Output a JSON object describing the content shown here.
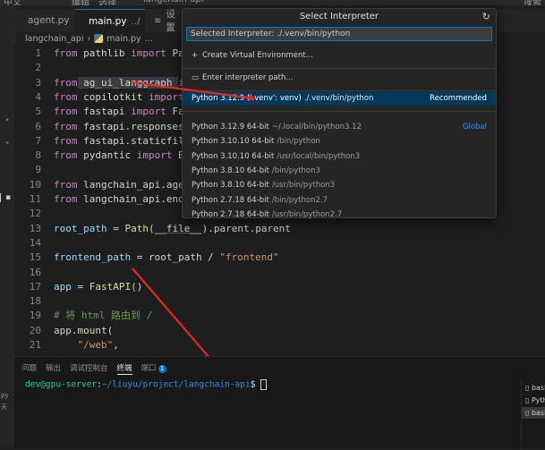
{
  "top_fragments": [
    "中文",
    "编辑",
    "选择",
    "langchain-api",
    "搜索"
  ],
  "tabs": [
    {
      "label": "agent.py"
    },
    {
      "label": "main.py",
      "suffix": "../"
    },
    {
      "label": "设置"
    }
  ],
  "breadcrumb": {
    "folder": "langchain_api",
    "sep": "›",
    "file": "main.py",
    "extra": "..."
  },
  "editor": {
    "lines": [
      {
        "n": "1",
        "parts": [
          [
            "kw",
            "from"
          ],
          [
            "plain",
            " pathlib "
          ],
          [
            "kw",
            "import"
          ],
          [
            "plain",
            " Path"
          ]
        ]
      },
      {
        "n": "2",
        "parts": []
      },
      {
        "n": "3",
        "parts": [
          [
            "kw",
            "from"
          ],
          [
            "plain",
            " ag_ui_langgraph "
          ],
          [
            "kw",
            "import"
          ]
        ]
      },
      {
        "n": "4",
        "parts": [
          [
            "kw",
            "from"
          ],
          [
            "plain",
            " copilotkit "
          ],
          [
            "kw",
            "import"
          ],
          [
            "plain",
            " La"
          ]
        ]
      },
      {
        "n": "5",
        "parts": [
          [
            "kw",
            "from"
          ],
          [
            "plain",
            " fastapi "
          ],
          [
            "kw",
            "import"
          ],
          [
            "plain",
            " FastAP"
          ]
        ]
      },
      {
        "n": "6",
        "parts": [
          [
            "kw",
            "from"
          ],
          [
            "plain",
            " fastapi.responses "
          ],
          [
            "kw",
            "imp"
          ]
        ]
      },
      {
        "n": "7",
        "parts": [
          [
            "kw",
            "from"
          ],
          [
            "plain",
            " fastapi.staticfiles "
          ],
          [
            "kw",
            "i"
          ]
        ]
      },
      {
        "n": "8",
        "parts": [
          [
            "kw",
            "from"
          ],
          [
            "plain",
            " pydantic "
          ],
          [
            "kw",
            "import"
          ],
          [
            "plain",
            " BaseM"
          ]
        ]
      },
      {
        "n": "9",
        "parts": []
      },
      {
        "n": "10",
        "parts": [
          [
            "kw",
            "from"
          ],
          [
            "plain",
            " langchain_api.agent.a"
          ]
        ]
      },
      {
        "n": "11",
        "parts": [
          [
            "kw",
            "from"
          ],
          [
            "plain",
            " langchain_api.endpoin"
          ]
        ]
      },
      {
        "n": "12",
        "parts": []
      },
      {
        "n": "13",
        "parts": [
          [
            "var",
            "root_path"
          ],
          [
            "plain",
            " = "
          ],
          [
            "fn",
            "Path"
          ],
          [
            "plain",
            "("
          ],
          [
            "dunder",
            "__file__"
          ],
          [
            "plain",
            ").parent.parent"
          ]
        ]
      },
      {
        "n": "14",
        "parts": []
      },
      {
        "n": "15",
        "parts": [
          [
            "var",
            "frontend_path"
          ],
          [
            "plain",
            " = root_path / "
          ],
          [
            "str",
            "\"frontend\""
          ]
        ]
      },
      {
        "n": "16",
        "parts": []
      },
      {
        "n": "17",
        "parts": [
          [
            "var",
            "app"
          ],
          [
            "plain",
            " = "
          ],
          [
            "fn",
            "FastAPI"
          ],
          [
            "plain",
            "()"
          ]
        ]
      },
      {
        "n": "18",
        "parts": []
      },
      {
        "n": "19",
        "parts": [
          [
            "cm",
            "# 将 html 路由到 /"
          ]
        ]
      },
      {
        "n": "20",
        "parts": [
          [
            "plain",
            "app."
          ],
          [
            "fn",
            "mount"
          ],
          [
            "plain",
            "("
          ]
        ]
      },
      {
        "n": "21",
        "parts": [
          [
            "plain",
            "    "
          ],
          [
            "str",
            "\"/web\""
          ],
          [
            "plain",
            ","
          ]
        ]
      }
    ]
  },
  "quick_pick": {
    "title": "Select Interpreter",
    "input_value": "Selected Interpreter: ./.venv/bin/python",
    "actions": [
      {
        "icon": "+",
        "label": "Create Virtual Environment..."
      },
      {
        "icon": "▭",
        "label": "Enter interpreter path..."
      }
    ],
    "recommended": {
      "name": "Python 3.12.9 ('.venv': venv)",
      "path": "./.venv/bin/python",
      "tag": "Recommended"
    },
    "items": [
      {
        "name": "Python 3.12.9 64-bit",
        "path": "~/.local/bin/python3.12",
        "tag": "Global"
      },
      {
        "name": "Python 3.10.10 64-bit",
        "path": "/bin/python",
        "tag": ""
      },
      {
        "name": "Python 3.10.10 64-bit",
        "path": "/usr/local/bin/python3",
        "tag": ""
      },
      {
        "name": "Python 3.8.10 64-bit",
        "path": "/bin/python3",
        "tag": ""
      },
      {
        "name": "Python 3.8.10 64-bit",
        "path": "/usr/bin/python3",
        "tag": ""
      },
      {
        "name": "Python 2.7.18 64-bit",
        "path": "/bin/python2.7",
        "tag": ""
      },
      {
        "name": "Python 2.7.18 64-bit",
        "path": "/usr/bin/python2.7",
        "tag": ""
      }
    ]
  },
  "panel": {
    "tabs": [
      "问题",
      "输出",
      "调试控制台",
      "终端",
      "端口"
    ],
    "ports_badge": "1",
    "terminal": {
      "user": "dev@gpu-server",
      "sep": ":",
      "path": "~/liuyu/project/langchain-api",
      "end": "$ "
    },
    "terminals": [
      "bash",
      "Python",
      "bash"
    ]
  },
  "left_fragments": [
    "py",
    "天"
  ],
  "colors": {
    "accent": "#0078d4",
    "arrow": "#e8291c",
    "selected": "#04395e"
  }
}
